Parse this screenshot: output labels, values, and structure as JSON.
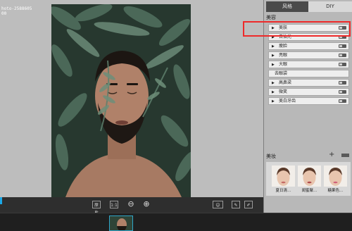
{
  "canvas": {
    "info_text_line1": "hoto-2588605",
    "info_text_line2": "00"
  },
  "toolbar": {
    "original_label": "原片",
    "actual_size_label": "1:1",
    "zoom_out_icon": "zoom-out-icon",
    "zoom_in_icon": "zoom-in-icon",
    "face_icon": "face-icon",
    "eraser_icon": "eraser-icon",
    "brush_icon": "brush-icon"
  },
  "panel": {
    "tabs": [
      {
        "label": "风格",
        "active": false
      },
      {
        "label": "DIY",
        "active": true
      }
    ],
    "beauty_section": {
      "title": "美容",
      "items": [
        {
          "label": "美肤",
          "highlighted": true
        },
        {
          "label": "去油光"
        },
        {
          "label": "瘦脸"
        },
        {
          "label": "亮眼"
        },
        {
          "label": "大眼"
        },
        {
          "label": "去眼袋"
        },
        {
          "label": "高鼻梁"
        },
        {
          "label": "微笑"
        },
        {
          "label": "美白牙齿"
        }
      ]
    },
    "makeup_section": {
      "title": "美妆",
      "add_icon": "plus-icon",
      "presets": [
        {
          "label": "夏日清…"
        },
        {
          "label": "闺蜜聚…"
        },
        {
          "label": "糖果色…"
        }
      ]
    }
  },
  "colors": {
    "highlight": "#ee2a2a",
    "selection": "#2fa6c8"
  }
}
